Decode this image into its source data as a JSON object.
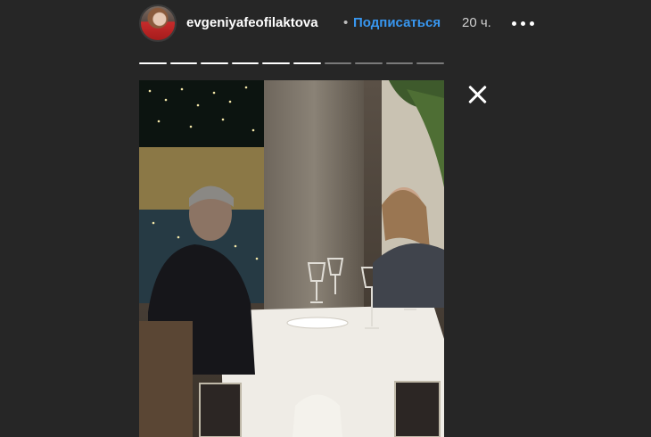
{
  "header": {
    "username": "evgeniyafeofilaktova",
    "separator": "•",
    "follow_label": "Подписаться",
    "time_ago": "20 ч."
  },
  "progress": {
    "segments": 10,
    "completed": 6
  },
  "icons": {
    "more": "more-icon",
    "close": "close-icon"
  },
  "colors": {
    "background": "#262626",
    "follow": "#3897f0"
  }
}
